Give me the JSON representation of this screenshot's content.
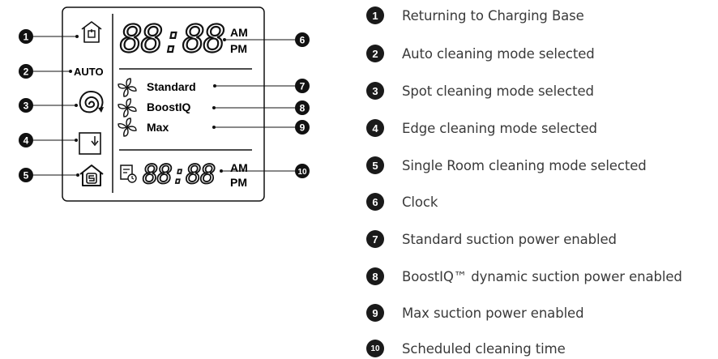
{
  "display": {
    "auto_label": "AUTO",
    "clock_digits": "88:88",
    "clock_am": "AM",
    "clock_pm": "PM",
    "schedule_digits": "88:88",
    "schedule_am": "AM",
    "schedule_pm": "PM",
    "suction_modes": [
      "Standard",
      "BoostIQ",
      "Max"
    ]
  },
  "callouts": [
    "1",
    "2",
    "3",
    "4",
    "5",
    "6",
    "7",
    "8",
    "9",
    "10"
  ],
  "legend": [
    {
      "number": "1",
      "text": "Returning to Charging Base"
    },
    {
      "number": "2",
      "text": "Auto cleaning mode selected"
    },
    {
      "number": "3",
      "text": "Spot cleaning mode selected"
    },
    {
      "number": "4",
      "text": "Edge cleaning mode selected"
    },
    {
      "number": "5",
      "text": "Single Room cleaning mode selected"
    },
    {
      "number": "6",
      "text": "Clock"
    },
    {
      "number": "7",
      "text": "Standard suction power enabled"
    },
    {
      "number": "8",
      "text": "BoostIQ™ dynamic suction power enabled"
    },
    {
      "number": "9",
      "text": "Max suction power enabled"
    },
    {
      "number": "10",
      "text": "Scheduled cleaning time"
    }
  ]
}
